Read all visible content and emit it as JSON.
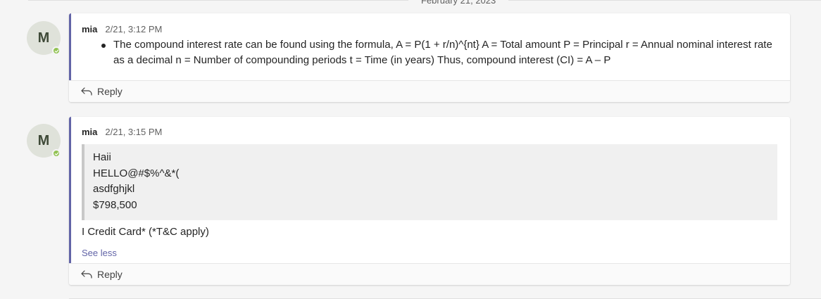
{
  "date_divider": "February 21, 2023",
  "messages": [
    {
      "avatar_initial": "M",
      "author": "mia",
      "time": "2/21, 3:12 PM",
      "bullet_text": "The compound interest rate can be found using the formula, A = P(1 + r/n)^{nt} A = Total amount P = Principal r = Annual nominal interest rate as a decimal n = Number of compounding periods t = Time (in years) Thus, compound interest (CI) = A – P",
      "reply_label": "Reply"
    },
    {
      "avatar_initial": "M",
      "author": "mia",
      "time": "2/21, 3:15 PM",
      "quote_lines": [
        "Haii",
        "HELLO@#$%^&*(",
        "asdfghjkl",
        "$798,500"
      ],
      "text": "I Credit Card* (*T&C apply)",
      "see_less_label": "See less",
      "reply_label": "Reply"
    }
  ],
  "colors": {
    "accent": "#6264a7",
    "presence_available": "#92c353",
    "avatar_bg": "#dfe2da"
  }
}
